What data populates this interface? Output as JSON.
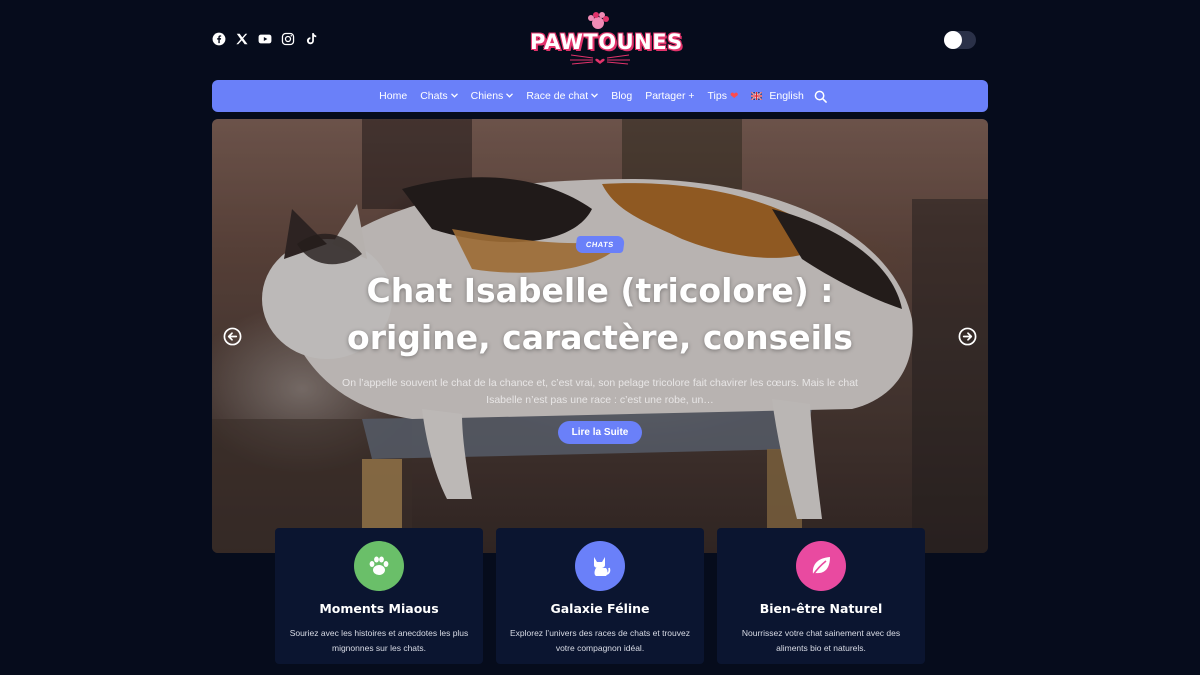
{
  "header": {
    "socials": [
      {
        "icon": "facebook-icon"
      },
      {
        "icon": "x-icon"
      },
      {
        "icon": "youtube-icon"
      },
      {
        "icon": "instagram-icon"
      },
      {
        "icon": "tiktok-icon"
      }
    ],
    "logo_text": "PAWTOUNES",
    "theme_toggle": {
      "state": "off"
    }
  },
  "nav": {
    "items": [
      {
        "label": "Home"
      },
      {
        "label": "Chats",
        "chevron": "˅"
      },
      {
        "label": "Chiens",
        "chevron": "˅"
      },
      {
        "label": "Race de chat",
        "chevron": "˅"
      },
      {
        "label": "Blog"
      },
      {
        "label": "Partager +"
      },
      {
        "label": "Tips",
        "emoji": "❤"
      },
      {
        "label": "English"
      }
    ],
    "search_icon": "search-icon"
  },
  "hero": {
    "category": "CHATS",
    "title": "Chat Isabelle (tricolore) : origine, caractère, conseils",
    "excerpt": "On l’appelle souvent le chat de la chance et, c’est vrai, son pelage tricolore fait chavirer les cœurs. Mais le chat Isabelle n’est pas une race : c’est une robe, un…",
    "cta": "Lire la Suite"
  },
  "features": [
    {
      "icon": "paw-icon",
      "color": "#6abf69",
      "title": "Moments Miaous",
      "desc": "Souriez avec les histoires et anecdotes les plus mignonnes sur les chats."
    },
    {
      "icon": "cat-icon",
      "color": "#6a80f9",
      "title": "Galaxie Féline",
      "desc": "Explorez l’univers des races de chats et trouvez votre compagnon idéal."
    },
    {
      "icon": "leaf-icon",
      "color": "#e94aa0",
      "title": "Bien-être Naturel",
      "desc": "Nourrissez votre chat sainement avec des aliments bio et naturels."
    }
  ],
  "colors": {
    "background": "#060c1c",
    "accent": "#6a80f9",
    "card": "#0b1530",
    "logo_pink": "#e2336b"
  }
}
